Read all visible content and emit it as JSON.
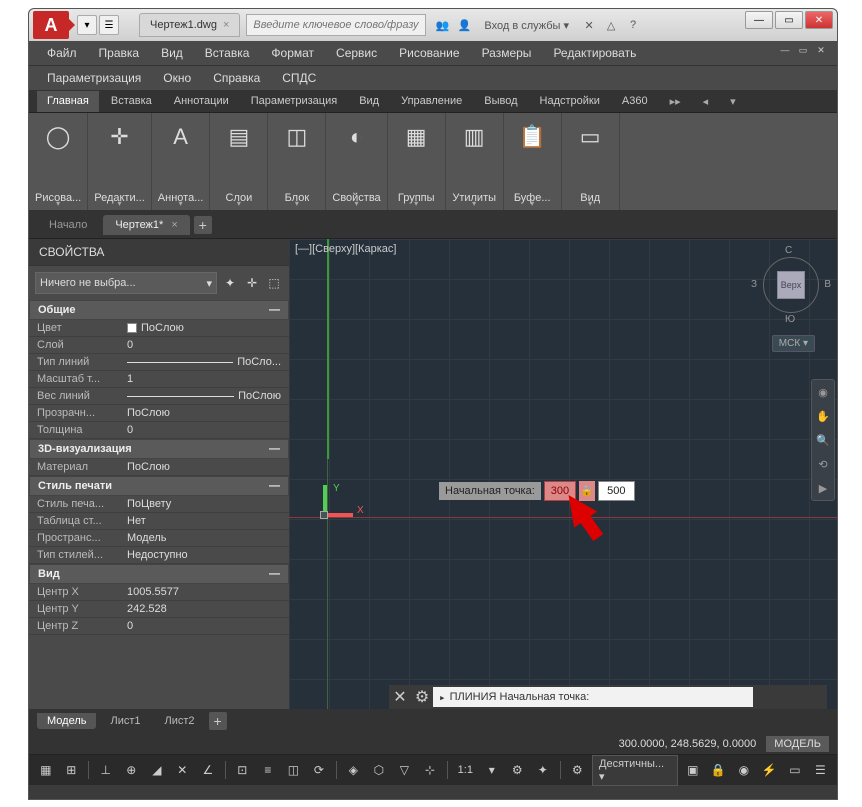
{
  "app_logo_letter": "A",
  "title_tab": "Чертеж1.dwg",
  "search_placeholder": "Введите ключевое слово/фразу",
  "signin_text": "Вход в службы",
  "menu": {
    "items": [
      "Файл",
      "Правка",
      "Вид",
      "Вставка",
      "Формат",
      "Сервис",
      "Рисование",
      "Размеры",
      "Редактировать",
      "Параметризация",
      "Окно",
      "Справка",
      "СПДС"
    ]
  },
  "ribbon": {
    "tabs": [
      "Главная",
      "Вставка",
      "Аннотации",
      "Параметризация",
      "Вид",
      "Управление",
      "Вывод",
      "Надстройки",
      "A360"
    ],
    "active": 0,
    "panels": [
      {
        "label": "Рисова...",
        "icon": "◯"
      },
      {
        "label": "Редакти...",
        "icon": "✛"
      },
      {
        "label": "Аннота...",
        "icon": "A"
      },
      {
        "label": "Слои",
        "icon": "▤"
      },
      {
        "label": "Блок",
        "icon": "◫"
      },
      {
        "label": "Свойства",
        "icon": "◐"
      },
      {
        "label": "Группы",
        "icon": "▦"
      },
      {
        "label": "Утилиты",
        "icon": "▥"
      },
      {
        "label": "Буфе...",
        "icon": "📋"
      },
      {
        "label": "Вид",
        "icon": "▭"
      }
    ]
  },
  "doc_tabs": {
    "items": [
      "Начало",
      "Чертеж1*"
    ],
    "active": 1
  },
  "properties": {
    "title": "СВОЙСТВА",
    "selection": "Ничего не выбра...",
    "sections": [
      {
        "header": "Общие",
        "rows": [
          {
            "k": "Цвет",
            "v": "ПоСлою",
            "swatch": true
          },
          {
            "k": "Слой",
            "v": "0"
          },
          {
            "k": "Тип линий",
            "v": "ПоСло...",
            "line": true
          },
          {
            "k": "Масштаб т...",
            "v": "1"
          },
          {
            "k": "Вес линий",
            "v": "ПоСлою",
            "line": true
          },
          {
            "k": "Прозрачн...",
            "v": "ПоСлою"
          },
          {
            "k": "Толщина",
            "v": "0"
          }
        ]
      },
      {
        "header": "3D-визуализация",
        "rows": [
          {
            "k": "Материал",
            "v": "ПоСлою"
          }
        ]
      },
      {
        "header": "Стиль печати",
        "rows": [
          {
            "k": "Стиль печа...",
            "v": "ПоЦвету"
          },
          {
            "k": "Таблица ст...",
            "v": "Нет"
          },
          {
            "k": "Пространс...",
            "v": "Модель"
          },
          {
            "k": "Тип стилей...",
            "v": "Недоступно"
          }
        ]
      },
      {
        "header": "Вид",
        "rows": [
          {
            "k": "Центр X",
            "v": "1005.5577"
          },
          {
            "k": "Центр Y",
            "v": "242.528"
          },
          {
            "k": "Центр Z",
            "v": "0"
          }
        ]
      }
    ]
  },
  "canvas": {
    "view_label": "[—][Сверху][Каркас]",
    "viewcube": {
      "top": "С",
      "right": "В",
      "bottom": "Ю",
      "left": "З",
      "face": "Верх"
    },
    "wcs": "МСК",
    "dyn_prompt": "Начальная точка:",
    "dyn_v1": "300",
    "dyn_v2": "500",
    "cmd_text": "ПЛИНИЯ Начальная точка:"
  },
  "layout_tabs": {
    "items": [
      "Модель",
      "Лист1",
      "Лист2"
    ],
    "active": 0
  },
  "status": {
    "coords": "300.0000, 248.5629, 0.0000",
    "model": "МОДЕЛЬ"
  },
  "toolbar": {
    "scale": "1:1",
    "units": "Десятичны..."
  }
}
